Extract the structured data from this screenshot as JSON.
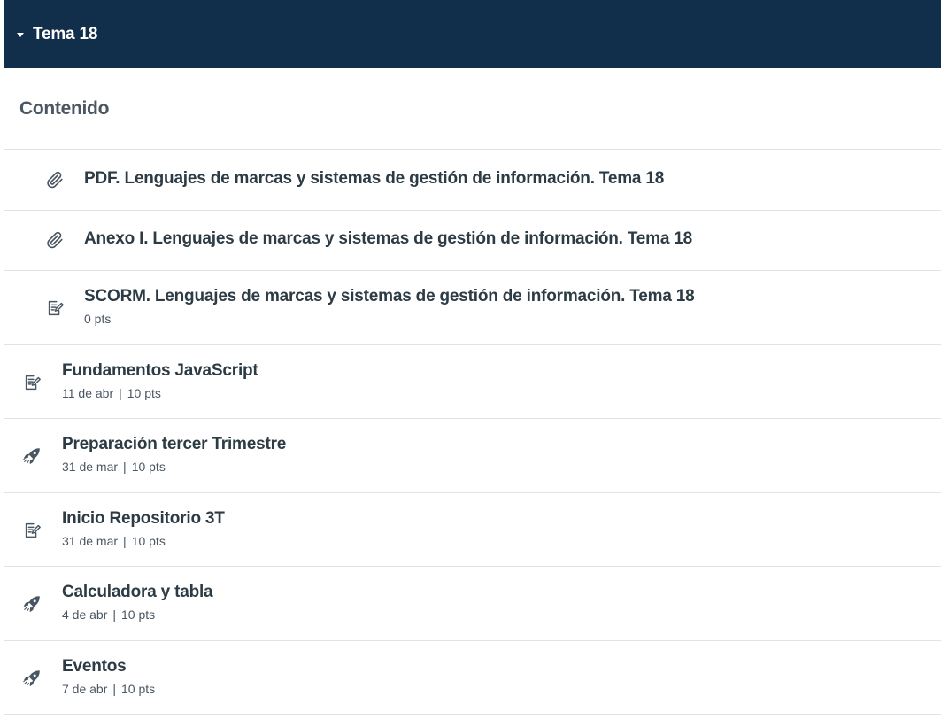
{
  "module": {
    "title": "Tema 18",
    "subheader": "Contenido"
  },
  "items": [
    {
      "title": "PDF. Lenguajes de marcas y sistemas de gestión de información. Tema 18",
      "icon": "paperclip-icon"
    },
    {
      "title": "Anexo I. Lenguajes de marcas y sistemas de gestión de información. Tema 18",
      "icon": "paperclip-icon"
    },
    {
      "title": "SCORM. Lenguajes de marcas y sistemas de gestión de información. Tema 18",
      "icon": "assignment-icon",
      "points": "0 pts"
    },
    {
      "title": "Fundamentos JavaScript",
      "icon": "assignment-icon",
      "date": "11 de abr",
      "points": "10 pts"
    },
    {
      "title": "Preparación tercer Trimestre",
      "icon": "rocket-icon",
      "date": "31 de mar",
      "points": "10 pts"
    },
    {
      "title": "Inicio Repositorio 3T",
      "icon": "assignment-icon",
      "date": "31 de mar",
      "points": "10 pts"
    },
    {
      "title": "Calculadora y tabla",
      "icon": "rocket-icon",
      "date": "4 de abr",
      "points": "10 pts"
    },
    {
      "title": "Eventos",
      "icon": "rocket-icon",
      "date": "7 de abr",
      "points": "10 pts"
    }
  ],
  "colors": {
    "header_bg": "#112e4a",
    "header_text": "#ffffff",
    "title_text": "#2d3b45",
    "meta_text": "#4a5661",
    "border": "#dfe3e6"
  }
}
